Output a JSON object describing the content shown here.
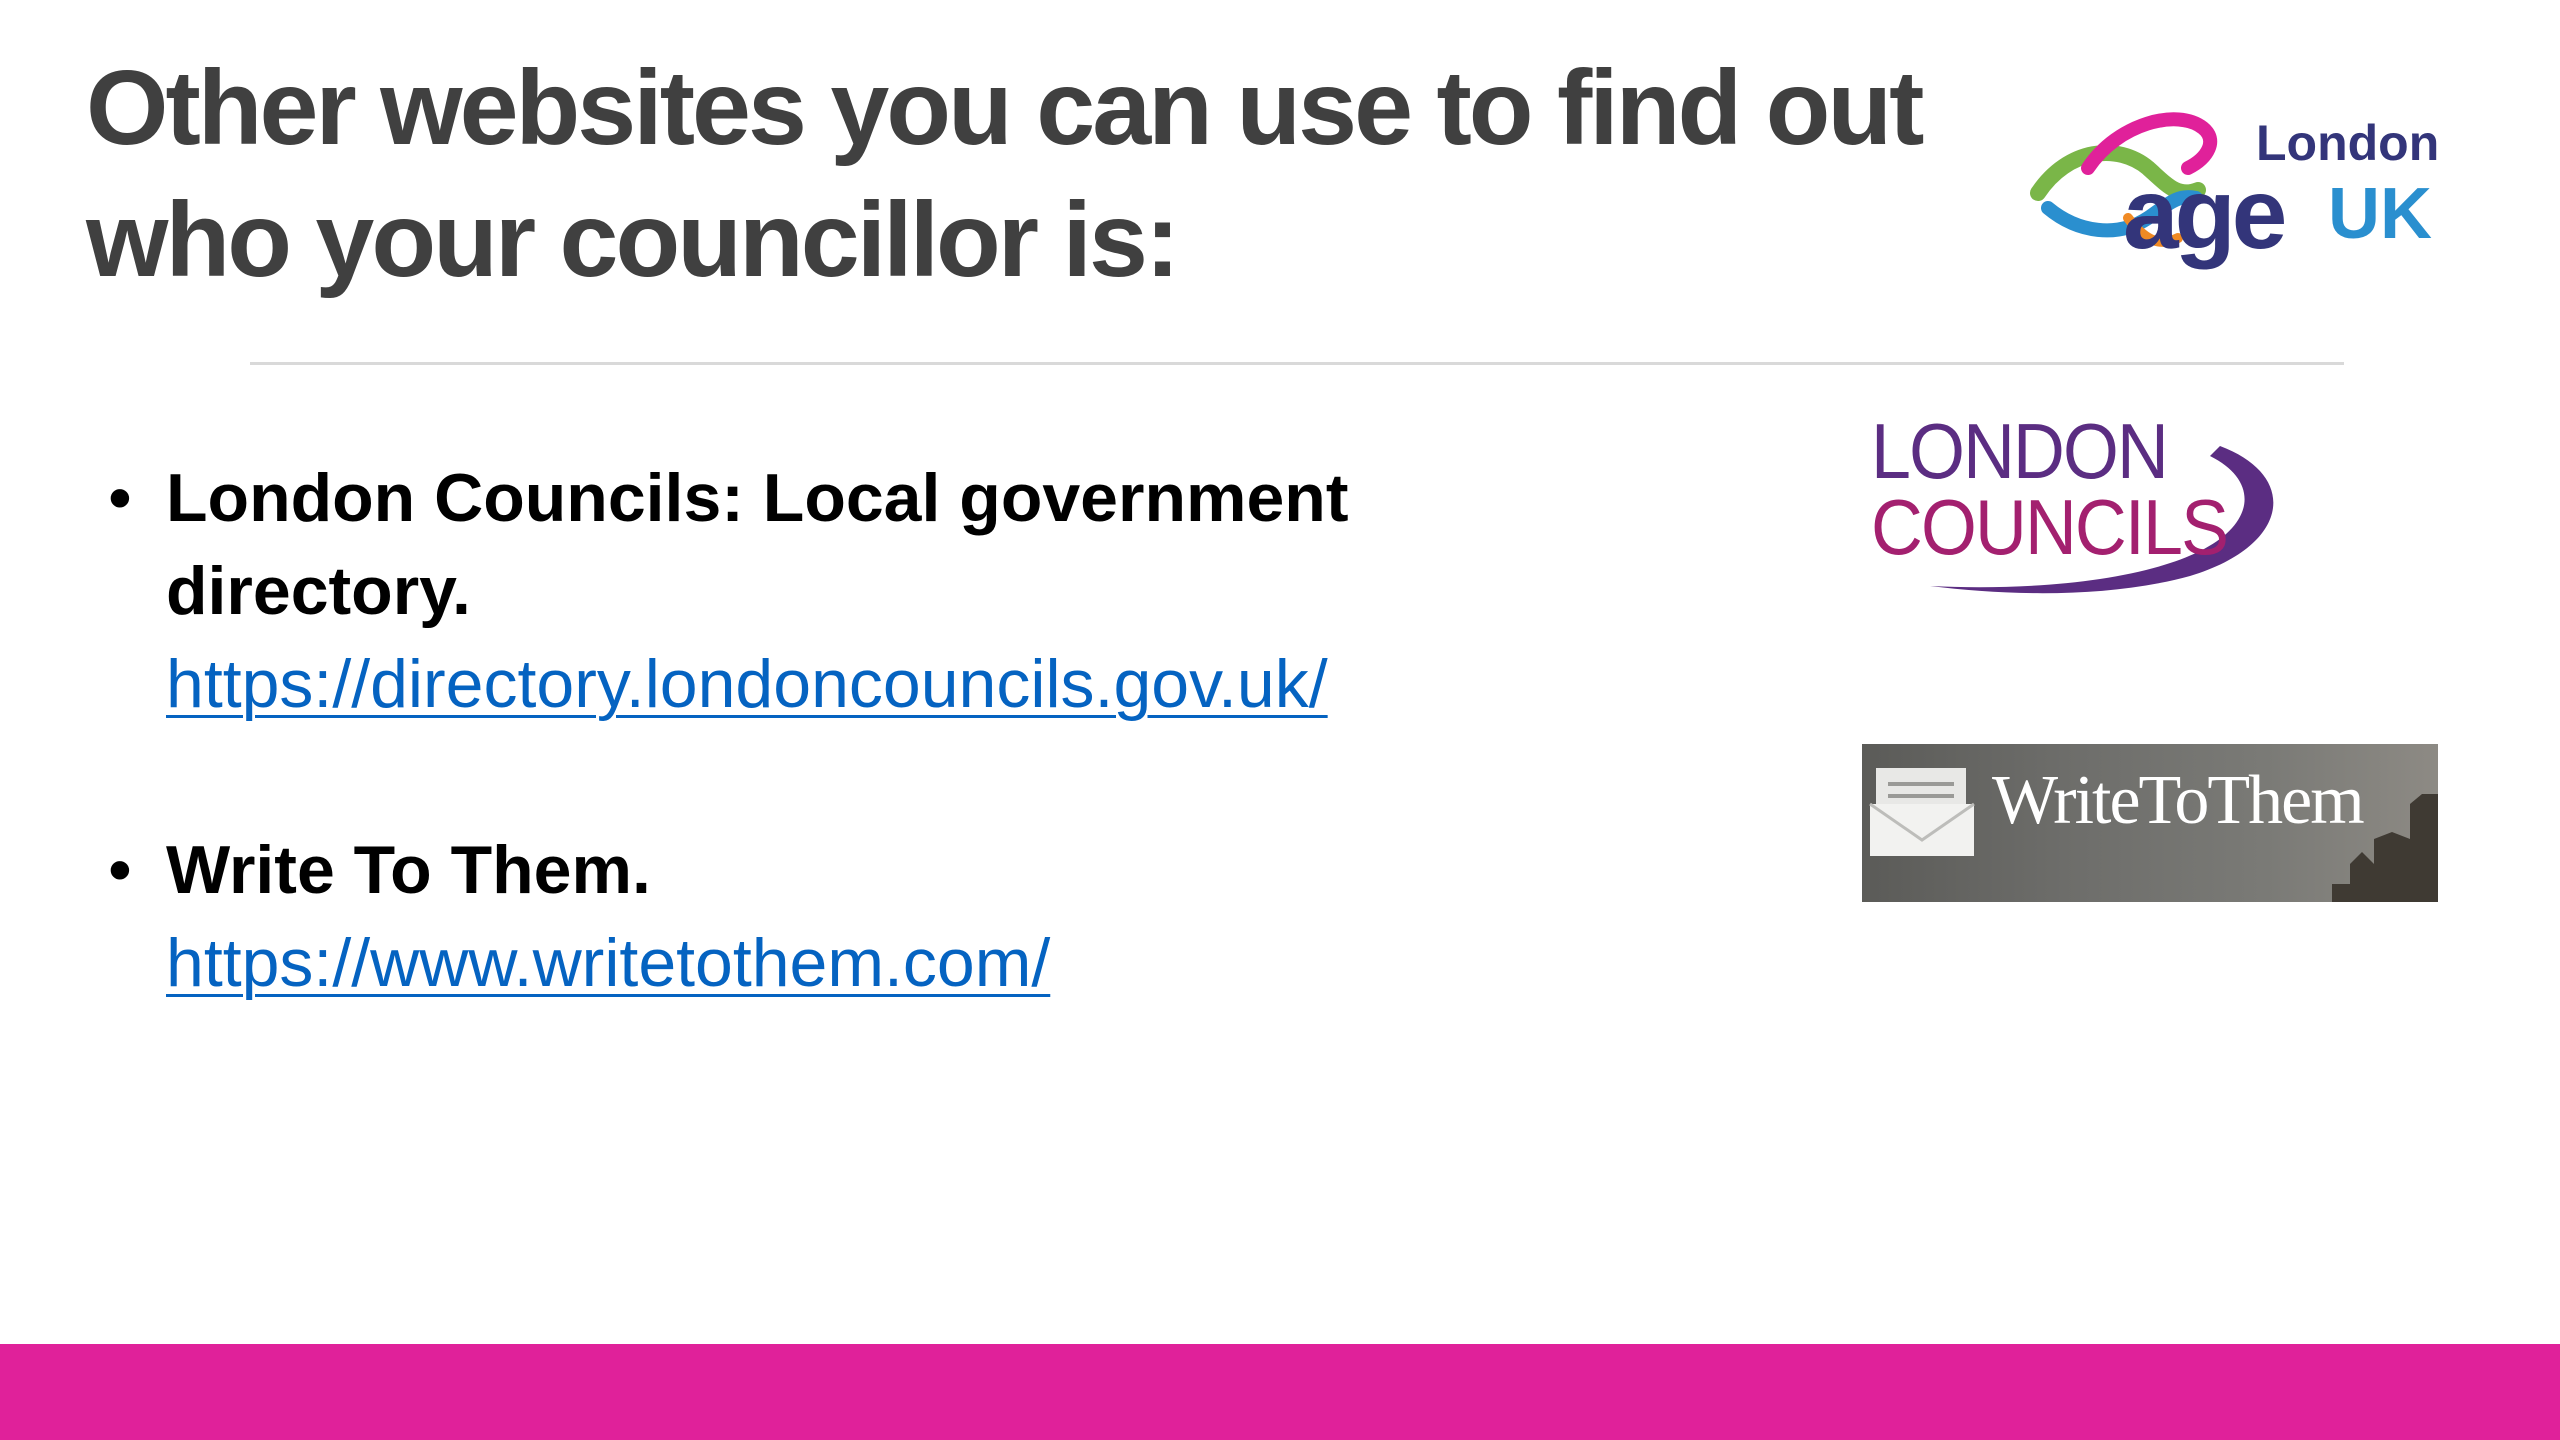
{
  "slide": {
    "title_line1": "Other websites you can use to find out",
    "title_line2": "who your councillor is:",
    "bullets": [
      {
        "heading_line1": "London Councils: Local government",
        "heading_line2": "directory.",
        "link": "https://directory.londoncouncils.gov.uk/"
      },
      {
        "heading_line1": "Write To Them.",
        "link": "https://www.writetothem.com/"
      }
    ]
  },
  "logos": {
    "ageuk_region": "London",
    "ageuk_word": "age",
    "ageuk_uk": "UK",
    "lc_line1": "LONDON",
    "lc_line2": "COUNCILS",
    "wtt_text": "WriteToThem"
  },
  "colors": {
    "title": "#404040",
    "link": "#0563c1",
    "accent_bar": "#e0219a",
    "ageuk_navy": "#33357a",
    "lc_purple": "#5b2d82",
    "lc_magenta": "#a3206f"
  }
}
